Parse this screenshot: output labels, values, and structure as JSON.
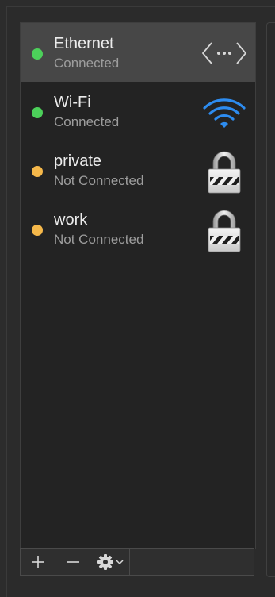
{
  "services": [
    {
      "name": "Ethernet",
      "status": "Connected",
      "status_color": "#4cd05a",
      "icon": "ethernet-icon",
      "selected": true
    },
    {
      "name": "Wi-Fi",
      "status": "Connected",
      "status_color": "#4cd05a",
      "icon": "wifi-icon",
      "selected": false
    },
    {
      "name": "private",
      "status": "Not Connected",
      "status_color": "#f5b84a",
      "icon": "vpn-lock-icon",
      "selected": false
    },
    {
      "name": "work",
      "status": "Not Connected",
      "status_color": "#f5b84a",
      "icon": "vpn-lock-icon",
      "selected": false
    }
  ],
  "toolbar": {
    "add_icon": "plus-icon",
    "remove_icon": "minus-icon",
    "action_icon": "gear-icon"
  },
  "colors": {
    "connected": "#4cd05a",
    "not_connected": "#f5b84a",
    "wifi": "#2d8cf0",
    "selection": "#474747"
  }
}
